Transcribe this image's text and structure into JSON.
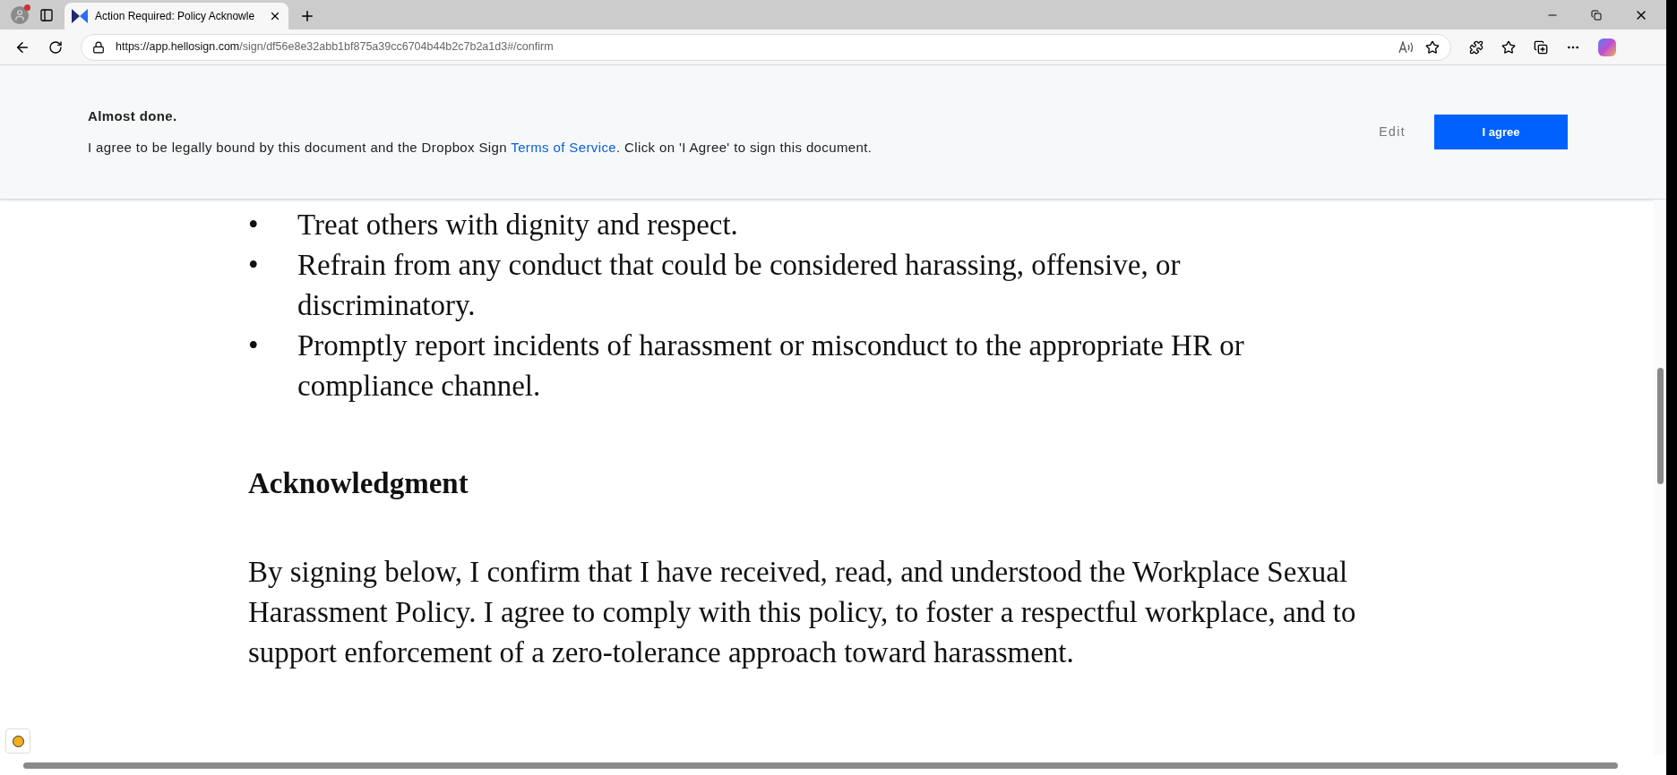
{
  "browser": {
    "tabs": [
      {
        "title": "Action Required: Policy Acknowle",
        "selected": true
      }
    ],
    "address": {
      "host": "https://app.hellosign.com",
      "path": "/sign/df56e8e32abb1bf875a39cc6704b44b2c7b2a1d3#/confirm"
    }
  },
  "banner": {
    "title": "Almost done.",
    "text_before": "I agree to be legally bound by this document and the Dropbox Sign ",
    "link": "Terms of Service",
    "text_after": ". Click on 'I Agree' to sign this document.",
    "buttons": [
      {
        "label": "Edit",
        "kind": "secondary"
      },
      {
        "label": "I agree",
        "kind": "primary"
      }
    ]
  },
  "document": {
    "bullets": [
      "Treat others with dignity and respect.",
      "Refrain from any conduct that could be considered harassing, offensive, or discriminatory.",
      "Promptly report incidents of harassment or misconduct to the appropriate HR or compliance channel."
    ],
    "bullet_char": "•",
    "heading": "Acknowledgment",
    "paragraph": "By signing below, I confirm that I have received, read, and understood the Workplace Sexual Harassment Policy. I agree to comply with this policy, to foster a respectful workplace, and to support enforcement of a zero-tolerance approach toward harassment."
  }
}
